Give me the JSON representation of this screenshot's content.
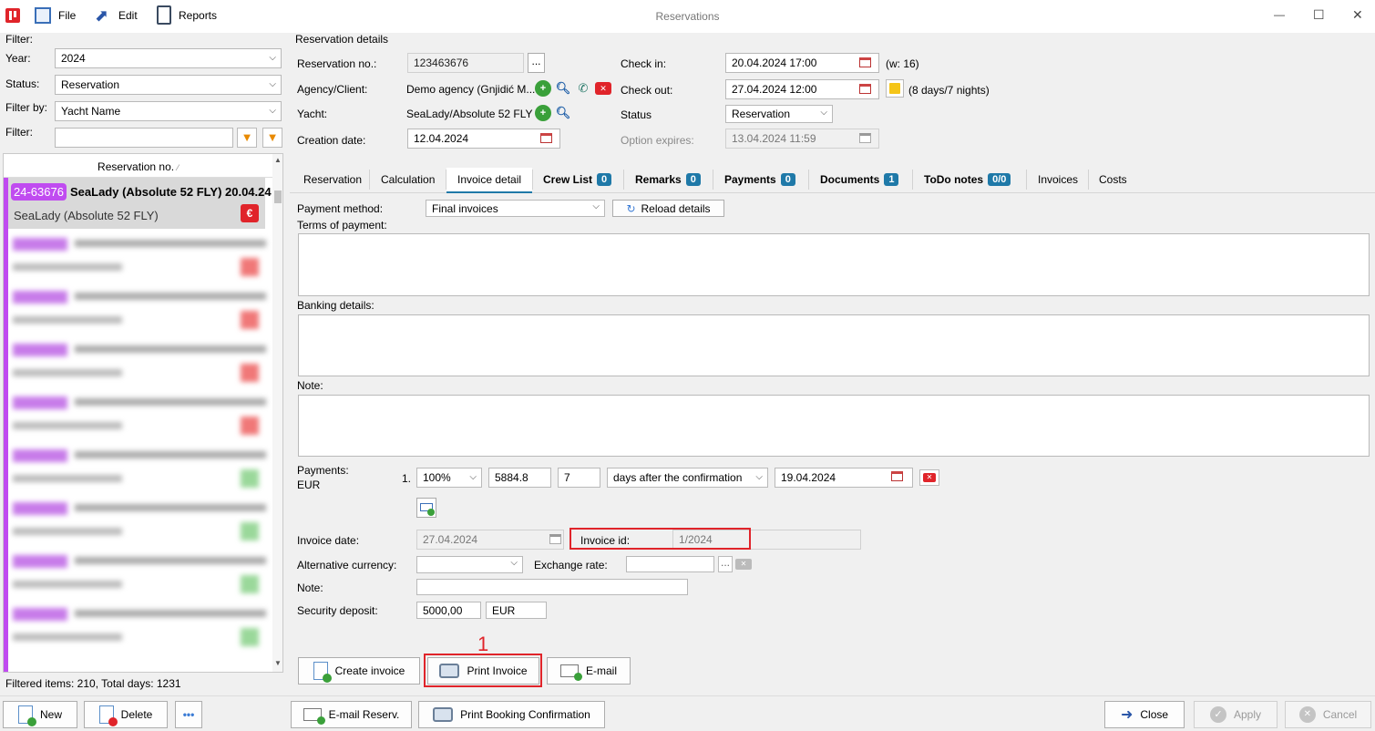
{
  "titlebar": {
    "title": "Reservations",
    "menu": [
      "File",
      "Edit",
      "Reports"
    ],
    "controls": {
      "minimize": "—",
      "maximize": "☐",
      "close": "✕"
    }
  },
  "filter": {
    "heading": "Filter:",
    "year_label": "Year:",
    "year_value": "2024",
    "status_label": "Status:",
    "status_value": "Reservation",
    "filterby_label": "Filter by:",
    "filterby_value": "Yacht Name",
    "filter_label": "Filter:",
    "filter_value": ""
  },
  "list": {
    "column_header": "Reservation no.",
    "selected": {
      "badge": "24-63676",
      "title": "SeaLady (Absolute 52 FLY) 20.04.24",
      "subtitle": "SeaLady (Absolute 52 FLY)",
      "pay_icon": "€"
    },
    "footer": "Filtered items: 210,  Total days: 1231"
  },
  "details": {
    "group_title": "Reservation details",
    "reservation_no_label": "Reservation no.:",
    "reservation_no_value": "123463676",
    "ellipsis": "...",
    "agency_label": "Agency/Client:",
    "agency_value": "Demo agency (Gnjidić M...",
    "yacht_label": "Yacht:",
    "yacht_value": "SeaLady/Absolute 52 FLY",
    "creation_label": "Creation date:",
    "creation_value": "12.04.2024",
    "checkin_label": "Check in:",
    "checkin_value": "20.04.2024 17:00",
    "week": "(w: 16)",
    "checkout_label": "Check out:",
    "checkout_value": "27.04.2024 12:00",
    "duration": "(8 days/7 nights)",
    "status_label": "Status",
    "status_value": "Reservation",
    "option_label": "Option expires:",
    "option_value": "13.04.2024 11:59"
  },
  "tabs": [
    {
      "label": "Reservation",
      "badge": ""
    },
    {
      "label": "Calculation",
      "badge": ""
    },
    {
      "label": "Invoice detail",
      "badge": ""
    },
    {
      "label": "Crew List",
      "badge": "0"
    },
    {
      "label": "Remarks",
      "badge": "0"
    },
    {
      "label": "Payments",
      "badge": "0"
    },
    {
      "label": "Documents",
      "badge": "1"
    },
    {
      "label": "ToDo notes",
      "badge": "0/0"
    },
    {
      "label": "Invoices",
      "badge": ""
    },
    {
      "label": "Costs",
      "badge": ""
    }
  ],
  "invoice": {
    "payment_method_label": "Payment method:",
    "payment_method_value": "Final invoices",
    "reload_label": "Reload details",
    "terms_label": "Terms of payment:",
    "banking_label": "Banking details:",
    "note_label": "Note:",
    "payments_label": "Payments:",
    "payments_currency": "EUR",
    "payment_row": {
      "index": "1.",
      "percent": "100%",
      "amount": "5884.8",
      "days": "7",
      "rule": "days after the confirmation",
      "date": "19.04.2024"
    },
    "invoice_date_label": "Invoice date:",
    "invoice_date_value": "27.04.2024",
    "invoice_id_label": "Invoice id:",
    "invoice_id_value": "1/2024",
    "alt_currency_label": "Alternative currency:",
    "alt_currency_value": "",
    "exchange_label": "Exchange rate:",
    "exchange_value": "",
    "exchange_ellipsis": "...",
    "note2_label": "Note:",
    "note2_value": "",
    "deposit_label": "Security deposit:",
    "deposit_value": "5000,00",
    "deposit_currency": "EUR",
    "annotation_number": "1",
    "create_invoice": "Create invoice",
    "print_invoice": "Print Invoice",
    "email": "E-mail"
  },
  "bottom": {
    "new": "New",
    "delete": "Delete",
    "more": "•••",
    "email_reserv": "E-mail Reserv.",
    "print_booking": "Print Booking Confirmation",
    "close": "Close",
    "apply": "Apply",
    "cancel": "Cancel"
  },
  "colors": {
    "accent_purple": "#c04bf0",
    "red": "#e0242a",
    "badge_blue": "#1f79a8",
    "tab_underline": "#1f79a8"
  }
}
